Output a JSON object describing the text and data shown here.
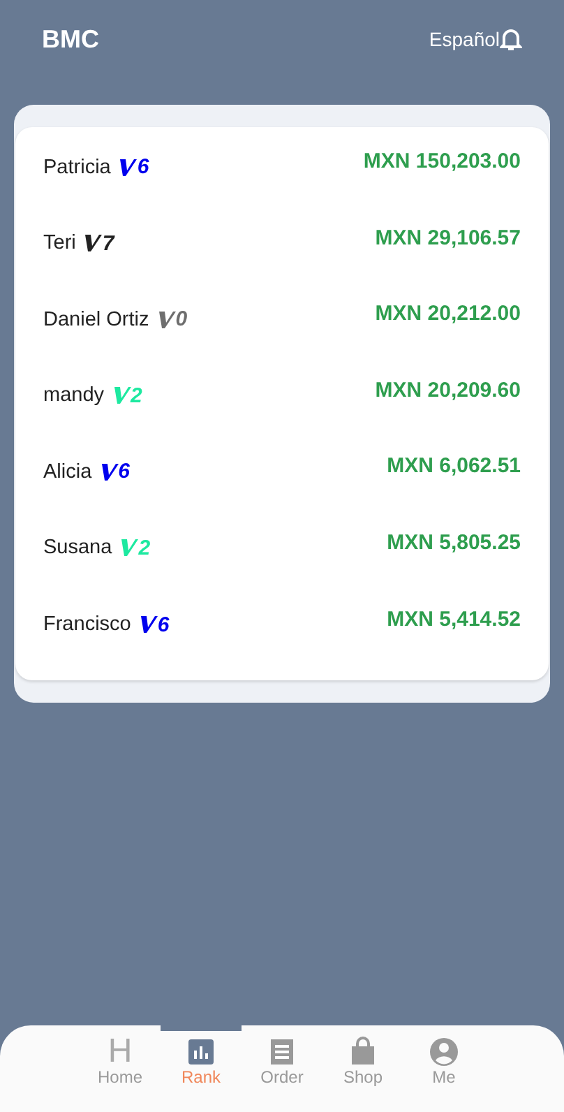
{
  "header": {
    "title": "BMC",
    "language": "Español"
  },
  "ranking": [
    {
      "name": "Patricia",
      "level": "6",
      "color": "#0000ee",
      "amount": "MXN 150,203.00"
    },
    {
      "name": "Teri",
      "level": "7",
      "color": "#222222",
      "amount": "MXN 29,106.57"
    },
    {
      "name": "Daniel Ortiz",
      "level": "0",
      "color": "#6e6e6e",
      "amount": "MXN 20,212.00"
    },
    {
      "name": "mandy",
      "level": "2",
      "color": "#1de9a0",
      "amount": "MXN 20,209.60"
    },
    {
      "name": "Alicia",
      "level": "6",
      "color": "#0000ee",
      "amount": "MXN 6,062.51"
    },
    {
      "name": "Susana",
      "level": "2",
      "color": "#1de9a0",
      "amount": "MXN 5,805.25"
    },
    {
      "name": "Francisco",
      "level": "6",
      "color": "#0000ee",
      "amount": "MXN 5,414.52"
    }
  ],
  "nav": [
    {
      "label": "Home",
      "kind": "letter",
      "glyph": "H",
      "selected": false
    },
    {
      "label": "Rank",
      "kind": "chart",
      "selected": true
    },
    {
      "label": "Order",
      "kind": "receipt",
      "selected": false
    },
    {
      "label": "Shop",
      "kind": "bag",
      "selected": false
    },
    {
      "label": "Me",
      "kind": "person",
      "selected": false
    }
  ]
}
